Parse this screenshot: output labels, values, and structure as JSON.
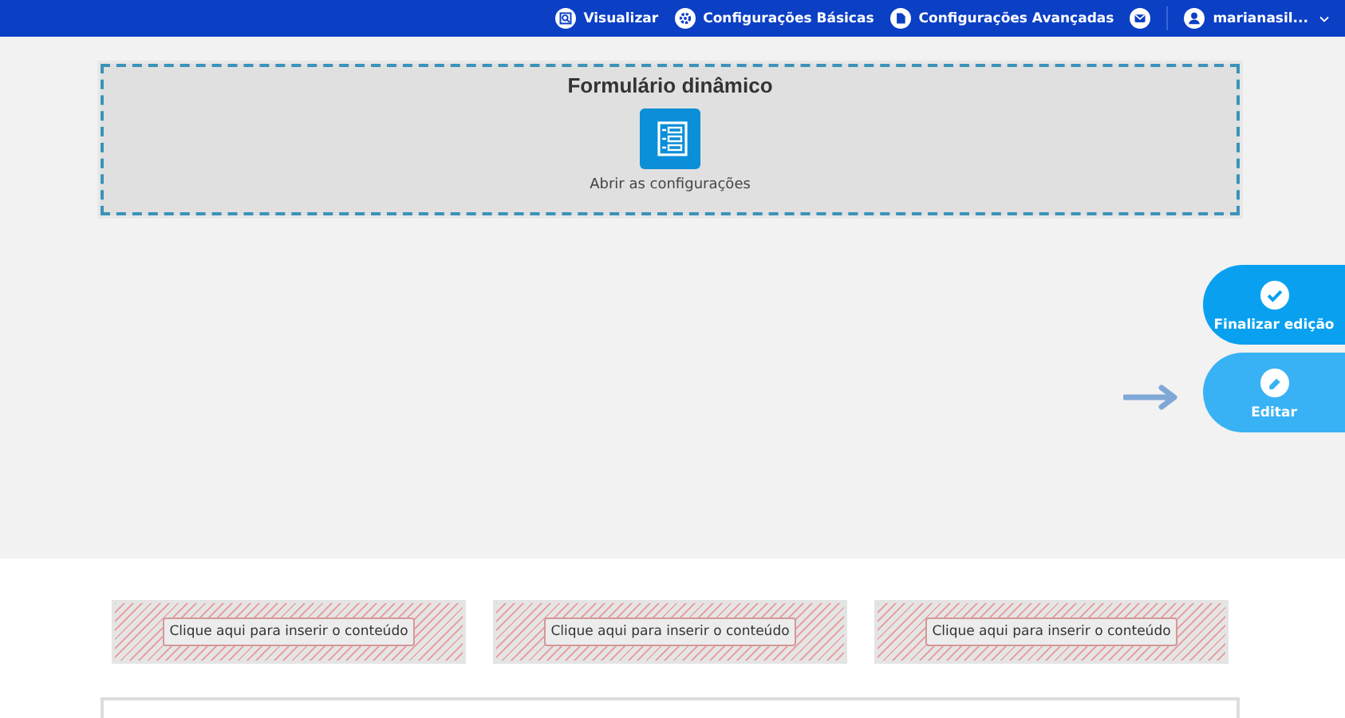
{
  "top_bar": {
    "items": [
      {
        "kind": "preview",
        "label": "Visualizar"
      },
      {
        "kind": "gear",
        "label": "Configurações Básicas"
      },
      {
        "kind": "file",
        "label": "Configurações Avançadas"
      },
      {
        "kind": "mail"
      },
      {
        "kind": "user",
        "label": "marianasil..."
      }
    ]
  },
  "form_widget": {
    "title": "Formulário dinâmico",
    "action": "Abrir as configurações"
  },
  "floating_buttons": [
    {
      "kind": "check",
      "label": "Finalizar edição",
      "highlighted": false
    },
    {
      "kind": "pencil",
      "label": "Editar",
      "highlighted": true
    }
  ],
  "slots": [
    {
      "label": "Clique aqui para inserir o conteúdo"
    },
    {
      "label": "Clique aqui para inserir o conteúdo"
    },
    {
      "label": "Clique aqui para inserir o conteúdo"
    }
  ]
}
